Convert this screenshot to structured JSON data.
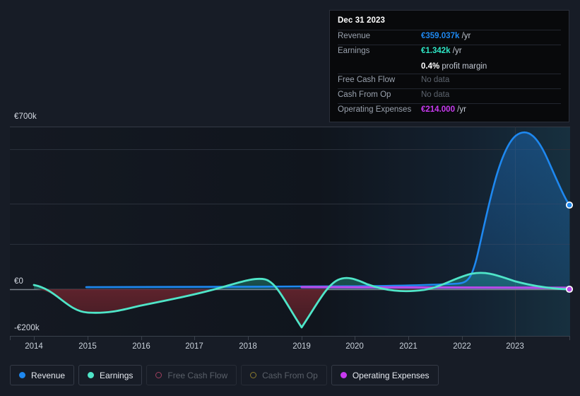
{
  "tooltip": {
    "date": "Dec 31 2023",
    "rows": [
      {
        "label": "Revenue",
        "value": "€359.037k",
        "unit": "/yr",
        "style": "v-revenue"
      },
      {
        "label": "Earnings",
        "value": "€1.342k",
        "unit": "/yr",
        "style": "v-earnings"
      },
      {
        "label": "Free Cash Flow",
        "value": "No data",
        "unit": "",
        "style": "nodata"
      },
      {
        "label": "Cash From Op",
        "value": "No data",
        "unit": "",
        "style": "nodata"
      },
      {
        "label": "Operating Expenses",
        "value": "€214.000",
        "unit": "/yr",
        "style": "v-opex"
      }
    ],
    "profit_margin_pct": "0.4%",
    "profit_margin_text": "profit margin"
  },
  "legend": {
    "items": [
      {
        "label": "Revenue",
        "color": "#1e88f0",
        "enabled": true,
        "dot": "dot-revenue"
      },
      {
        "label": "Earnings",
        "color": "#4fe5c8",
        "enabled": true,
        "dot": "dot-earnings"
      },
      {
        "label": "Free Cash Flow",
        "color": "#9e3f5e",
        "enabled": false,
        "dot": "dot-fcf"
      },
      {
        "label": "Cash From Op",
        "color": "#8a7a2e",
        "enabled": false,
        "dot": "dot-cfo"
      },
      {
        "label": "Operating Expenses",
        "color": "#c83af0",
        "enabled": true,
        "dot": "dot-opex"
      }
    ]
  },
  "axes": {
    "y_top_label": "€700k",
    "y_zero_label": "€0",
    "y_bottom_label": "-€200k",
    "x_labels": [
      "2014",
      "2015",
      "2016",
      "2017",
      "2018",
      "2019",
      "2020",
      "2021",
      "2022",
      "2023"
    ]
  },
  "chart_data": {
    "type": "area",
    "title": "",
    "xlabel": "",
    "ylabel": "",
    "currency": "EUR",
    "ylim": [
      -200000,
      700000
    ],
    "ytick_values": [
      700000,
      0,
      -200000
    ],
    "ytick_labels": [
      "€700k",
      "€0",
      "-€200k"
    ],
    "grid": true,
    "legend_position": "bottom",
    "x": [
      "2014",
      "2015",
      "2016",
      "2017",
      "2018",
      "2019",
      "2020",
      "2021",
      "2022",
      "2023"
    ],
    "series": [
      {
        "name": "Revenue",
        "color": "#1e88f0",
        "fill": true,
        "values": [
          null,
          6000,
          6000,
          6000,
          6000,
          6000,
          6000,
          6000,
          20000,
          680000
        ],
        "end_value": 359037,
        "note": "flat near zero from 2015 through 2022, spikes to about €680k peak just after 2023 then falls to €359.037k at the endpoint marker"
      },
      {
        "name": "Earnings",
        "color": "#4fe5c8",
        "fill": true,
        "values": [
          -2000,
          -38000,
          -32000,
          -18000,
          22000,
          -163000,
          28000,
          2000,
          50000,
          1342
        ],
        "end_value": 1342,
        "note": "dips negative around 2015, peaks positive near 2018, deep trough at 2019, secondary peak near 2022, ends at €1.342k"
      },
      {
        "name": "Free Cash Flow",
        "color": "#9e3f5e",
        "fill": false,
        "enabled": false,
        "values": [
          null,
          null,
          null,
          null,
          null,
          null,
          null,
          null,
          null,
          null
        ]
      },
      {
        "name": "Cash From Op",
        "color": "#8a7a2e",
        "fill": false,
        "enabled": false,
        "values": [
          null,
          null,
          null,
          null,
          null,
          null,
          null,
          null,
          null,
          null
        ]
      },
      {
        "name": "Operating Expenses",
        "color": "#c83af0",
        "fill": false,
        "values": [
          null,
          null,
          null,
          null,
          null,
          8000,
          8000,
          8000,
          8000,
          8000
        ],
        "end_value": 214000,
        "note": "flat thin line starting near 2019, runs to the right edge endpoint"
      }
    ],
    "highlight": {
      "date": "Dec 31 2023",
      "revenue": 359037,
      "earnings": 1342,
      "profit_margin": 0.4,
      "free_cash_flow": null,
      "cash_from_op": null,
      "operating_expenses": 214000
    }
  }
}
